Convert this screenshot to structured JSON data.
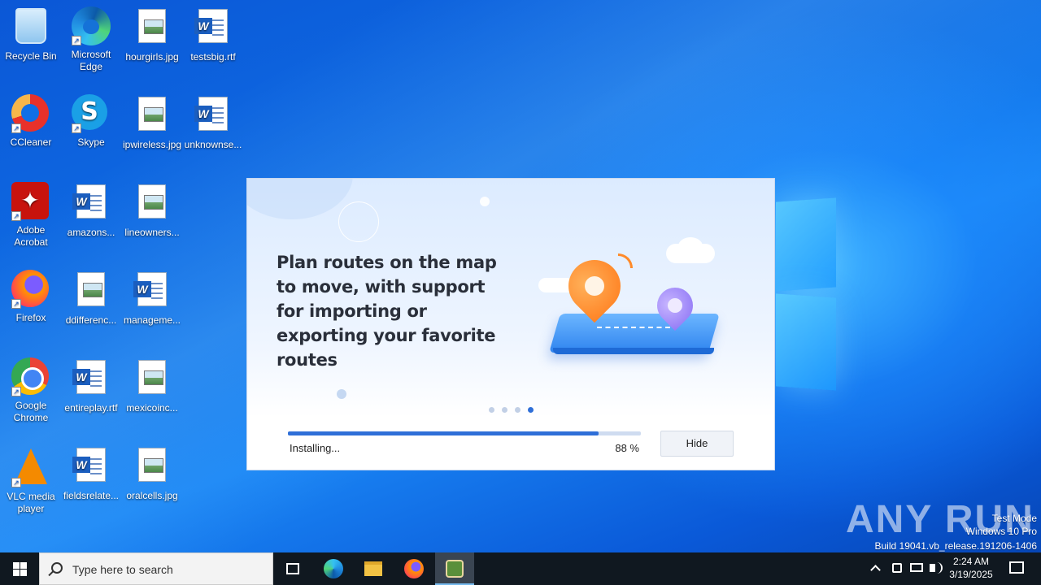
{
  "desktop": {
    "icons": [
      {
        "label": "Recycle Bin",
        "kind": "recycle-bin"
      },
      {
        "label": "Microsoft Edge",
        "kind": "edge"
      },
      {
        "label": "hourgirls.jpg",
        "kind": "image-file"
      },
      {
        "label": "testsbig.rtf",
        "kind": "word-file"
      },
      {
        "label": "CCleaner",
        "kind": "ccleaner"
      },
      {
        "label": "Skype",
        "kind": "skype"
      },
      {
        "label": "ipwireless.jpg",
        "kind": "image-file"
      },
      {
        "label": "unknownse...",
        "kind": "word-file"
      },
      {
        "label": "Adobe Acrobat",
        "kind": "acrobat"
      },
      {
        "label": "amazons...",
        "kind": "word-file"
      },
      {
        "label": "lineowners...",
        "kind": "image-file"
      },
      {
        "label": "Firefox",
        "kind": "firefox"
      },
      {
        "label": "ddifferenc...",
        "kind": "image-file"
      },
      {
        "label": "manageme...",
        "kind": "word-file"
      },
      {
        "label": "Google Chrome",
        "kind": "chrome"
      },
      {
        "label": "entireplay.rtf",
        "kind": "word-file"
      },
      {
        "label": "mexicoinc...",
        "kind": "image-file"
      },
      {
        "label": "VLC media player",
        "kind": "vlc"
      },
      {
        "label": "fieldsrelate...",
        "kind": "word-file"
      },
      {
        "label": "oralcells.jpg",
        "kind": "image-file"
      }
    ]
  },
  "installer": {
    "headline": "Plan routes on the map to move, with support for importing or exporting your favorite routes",
    "status_text": "Installing...",
    "progress_percent_label": "88 %",
    "progress_value": 0.88,
    "hide_label": "Hide",
    "carousel_dots": 4,
    "carousel_active_index": 3,
    "accent_color": "#2f6fd8"
  },
  "watermark": {
    "brand": "ANY RUN",
    "mode": "Test Mode",
    "os": "Windows 10 Pro",
    "build": "Build 19041.vb_release.191206-1406"
  },
  "taskbar": {
    "search_placeholder": "Type here to search",
    "pinned": [
      "task-view-icon",
      "edge-icon",
      "file-explorer-icon",
      "firefox-icon",
      "installer-app-icon"
    ],
    "clock_time": "2:24 AM",
    "clock_date": "3/19/2025"
  }
}
